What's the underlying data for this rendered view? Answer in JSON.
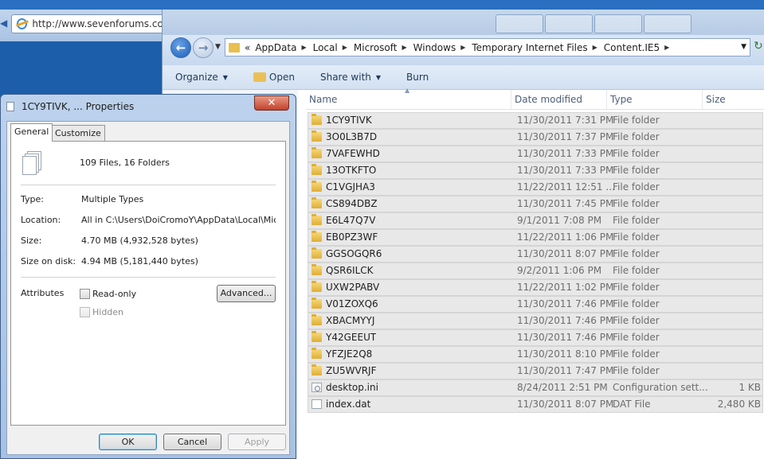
{
  "browser": {
    "url": "http://www.sevenforums.com"
  },
  "explorer": {
    "breadcrumb": [
      "AppData",
      "Local",
      "Microsoft",
      "Windows",
      "Temporary Internet Files",
      "Content.IE5"
    ],
    "overflow": "«",
    "commands": {
      "organize": "Organize",
      "open": "Open",
      "share_with": "Share with",
      "burn": "Burn"
    },
    "columns": {
      "name": "Name",
      "date_modified": "Date modified",
      "type": "Type",
      "size": "Size"
    },
    "files": [
      {
        "name": "1CY9TIVK",
        "date": "11/30/2011 7:31 PM",
        "type": "File folder",
        "size": "",
        "icon": "folder-icon"
      },
      {
        "name": "3O0L3B7D",
        "date": "11/30/2011 7:37 PM",
        "type": "File folder",
        "size": "",
        "icon": "folder-icon"
      },
      {
        "name": "7VAFEWHD",
        "date": "11/30/2011 7:33 PM",
        "type": "File folder",
        "size": "",
        "icon": "folder-icon"
      },
      {
        "name": "13OTKFTO",
        "date": "11/30/2011 7:33 PM",
        "type": "File folder",
        "size": "",
        "icon": "folder-icon"
      },
      {
        "name": "C1VGJHA3",
        "date": "11/22/2011 12:51 ...",
        "type": "File folder",
        "size": "",
        "icon": "folder-icon"
      },
      {
        "name": "CS894DBZ",
        "date": "11/30/2011 7:45 PM",
        "type": "File folder",
        "size": "",
        "icon": "folder-icon"
      },
      {
        "name": "E6L47Q7V",
        "date": "9/1/2011 7:08 PM",
        "type": "File folder",
        "size": "",
        "icon": "folder-icon"
      },
      {
        "name": "EB0PZ3WF",
        "date": "11/22/2011 1:06 PM",
        "type": "File folder",
        "size": "",
        "icon": "folder-icon"
      },
      {
        "name": "GGSOGQR6",
        "date": "11/30/2011 8:07 PM",
        "type": "File folder",
        "size": "",
        "icon": "folder-icon"
      },
      {
        "name": "QSR6ILCK",
        "date": "9/2/2011 1:06 PM",
        "type": "File folder",
        "size": "",
        "icon": "folder-icon"
      },
      {
        "name": "UXW2PABV",
        "date": "11/22/2011 1:02 PM",
        "type": "File folder",
        "size": "",
        "icon": "folder-icon"
      },
      {
        "name": "V01ZOXQ6",
        "date": "11/30/2011 7:46 PM",
        "type": "File folder",
        "size": "",
        "icon": "folder-icon"
      },
      {
        "name": "XBACMYYJ",
        "date": "11/30/2011 7:46 PM",
        "type": "File folder",
        "size": "",
        "icon": "folder-icon"
      },
      {
        "name": "Y42GEEUT",
        "date": "11/30/2011 7:46 PM",
        "type": "File folder",
        "size": "",
        "icon": "folder-icon"
      },
      {
        "name": "YFZJE2Q8",
        "date": "11/30/2011 8:10 PM",
        "type": "File folder",
        "size": "",
        "icon": "folder-icon"
      },
      {
        "name": "ZU5WVRJF",
        "date": "11/30/2011 7:47 PM",
        "type": "File folder",
        "size": "",
        "icon": "folder-icon"
      },
      {
        "name": "desktop.ini",
        "date": "8/24/2011 2:51 PM",
        "type": "Configuration sett...",
        "size": "1 KB",
        "icon": "settings-file-icon"
      },
      {
        "name": "index.dat",
        "date": "11/30/2011 8:07 PM",
        "type": "DAT File",
        "size": "2,480 KB",
        "icon": "file-icon"
      }
    ]
  },
  "dialog": {
    "title": "1CY9TIVK, ... Properties",
    "close_label": "✕",
    "tabs": [
      "General",
      "Customize"
    ],
    "summary": "109 Files, 16 Folders",
    "type_label": "Type:",
    "type_value": "Multiple Types",
    "location_label": "Location:",
    "location_value": "All in C:\\Users\\DoiCromoY\\AppData\\Local\\Microsoft",
    "size_label": "Size:",
    "size_value": "4.70 MB (4,932,528 bytes)",
    "size_on_disk_label": "Size on disk:",
    "size_on_disk_value": "4.94 MB (5,181,440 bytes)",
    "attributes_label": "Attributes",
    "readonly_label": "Read-only",
    "hidden_label": "Hidden",
    "advanced_label": "Advanced...",
    "ok_label": "OK",
    "cancel_label": "Cancel",
    "apply_label": "Apply"
  }
}
